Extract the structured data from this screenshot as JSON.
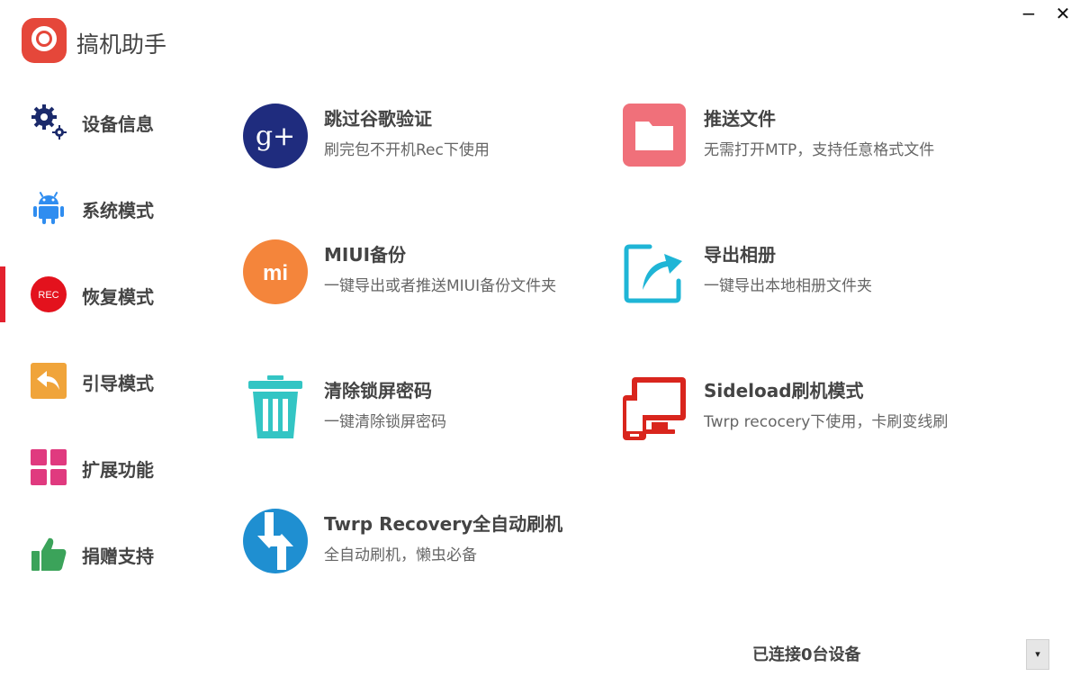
{
  "app": {
    "title": "搞机助手"
  },
  "window": {
    "minimize_symbol": "−",
    "close_symbol": "✕"
  },
  "sidebar": {
    "items": [
      {
        "label": "设备信息",
        "icon": "gears-icon"
      },
      {
        "label": "系统模式",
        "icon": "android-icon"
      },
      {
        "label": "恢复模式",
        "icon": "rec-icon",
        "icon_text": "REC",
        "active": true
      },
      {
        "label": "引导模式",
        "icon": "back-arrow-icon"
      },
      {
        "label": "扩展功能",
        "icon": "grid-icon"
      },
      {
        "label": "捐赠支持",
        "icon": "thumbs-up-icon"
      }
    ]
  },
  "features": [
    {
      "title": "跳过谷歌验证",
      "desc": "刷完包不开机Rec下使用",
      "icon": "google-plus-icon",
      "icon_text": "g+",
      "color": "#1f2c7e"
    },
    {
      "title": "推送文件",
      "desc": "无需打开MTP，支持任意格式文件",
      "icon": "folder-icon",
      "color": "#f0707a"
    },
    {
      "title": "MIUI备份",
      "desc": "一键导出或者推送MIUI备份文件夹",
      "icon": "mi-icon",
      "icon_text": "mi",
      "color": "#f4853b"
    },
    {
      "title": "导出相册",
      "desc": "一键导出本地相册文件夹",
      "icon": "export-icon",
      "color": "#1fb5d6"
    },
    {
      "title": "清除锁屏密码",
      "desc": "一键清除锁屏密码",
      "icon": "trash-icon",
      "color": "#33c5c4"
    },
    {
      "title": "Sideload刷机模式",
      "desc": "Twrp recocery下使用，卡刷变线刷",
      "icon": "devices-icon",
      "color": "#d9251d"
    },
    {
      "title": "Twrp Recovery全自动刷机",
      "desc": "全自动刷机，懒虫必备",
      "icon": "twrp-icon",
      "color": "#1f8fd1"
    }
  ],
  "footer": {
    "status": "已连接0台设备",
    "dropdown_symbol": "▾"
  }
}
